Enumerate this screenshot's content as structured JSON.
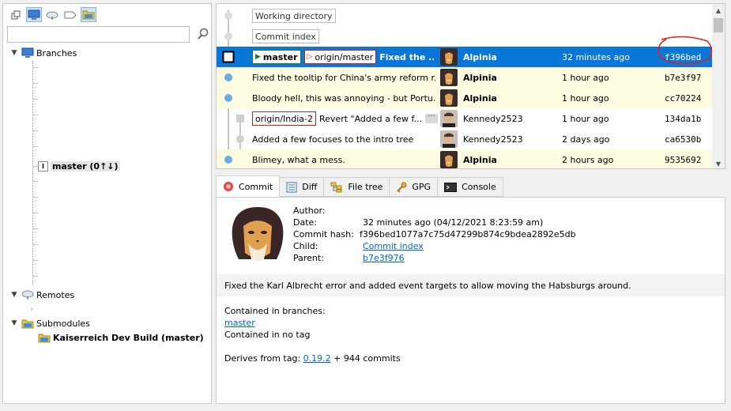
{
  "sidebar": {
    "search_placeholder": "",
    "branches_label": "Branches",
    "current_branch": "master (0↑↓)",
    "remotes_label": "Remotes",
    "submodules_label": "Submodules",
    "submodule_item": "Kaiserreich Dev Build (master)"
  },
  "commits": {
    "rows": [
      {
        "type": "virtual",
        "message": "Working directory"
      },
      {
        "type": "virtual",
        "message": "Commit index"
      },
      {
        "type": "commit",
        "local_ref": "master",
        "remote_ref": "origin/master",
        "message": "Fixed the ...",
        "author": "Alpinia",
        "date": "32 minutes ago",
        "sha": "f396bed"
      },
      {
        "type": "commit",
        "message": "Fixed the tooltip for China's army reform r...",
        "author": "Alpinia",
        "date": "1 hour ago",
        "sha": "b7e3f97"
      },
      {
        "type": "commit",
        "message": "Bloody hell, this was annoying - but Portu...",
        "author": "Alpinia",
        "date": "1 hour ago",
        "sha": "cc70224"
      },
      {
        "type": "commit",
        "remote_ref": "origin/India-2",
        "message": "Revert \"Added a few f...",
        "more": "···",
        "author": "Kennedy2523",
        "date": "1 hour ago",
        "sha": "134da1b"
      },
      {
        "type": "commit",
        "message": "Added a few focuses to the intro tree",
        "author": "Kennedy2523",
        "date": "2 days ago",
        "sha": "ca6530b"
      },
      {
        "type": "commit",
        "message": "Blimey, what a mess.",
        "author": "Alpinia",
        "date": "2 hours ago",
        "sha": "9535692"
      }
    ]
  },
  "tabs": [
    {
      "label": "Commit"
    },
    {
      "label": "Diff"
    },
    {
      "label": "File tree"
    },
    {
      "label": "GPG"
    },
    {
      "label": "Console"
    }
  ],
  "details": {
    "author_label": "Author:",
    "date_label": "Date:",
    "date_value": "32 minutes ago (04/12/2021 8:23:59 am)",
    "hash_label": "Commit hash:",
    "hash_value": "f396bed1077a7c75d47299b874c9bdea2892e5db",
    "child_label": "Child:",
    "child_value": "Commit index",
    "parent_label": "Parent:",
    "parent_value": "b7e3f976",
    "message": "Fixed the Karl Albrecht error and added event targets to allow moving the Habsburgs around.",
    "contained_branches_label": "Contained in branches:",
    "contained_branch": "master",
    "contained_tag": "Contained in no tag",
    "derives_label": "Derives from tag:",
    "derives_tag": "0.19.2",
    "derives_suffix": "+ 944 commits"
  },
  "colors": {
    "selection": "#0a76d8",
    "highlight_row": "#fdfce1",
    "local_branch": "#1b7d1b",
    "remote_branch": "#bb2222",
    "annotation": "#e02020"
  }
}
